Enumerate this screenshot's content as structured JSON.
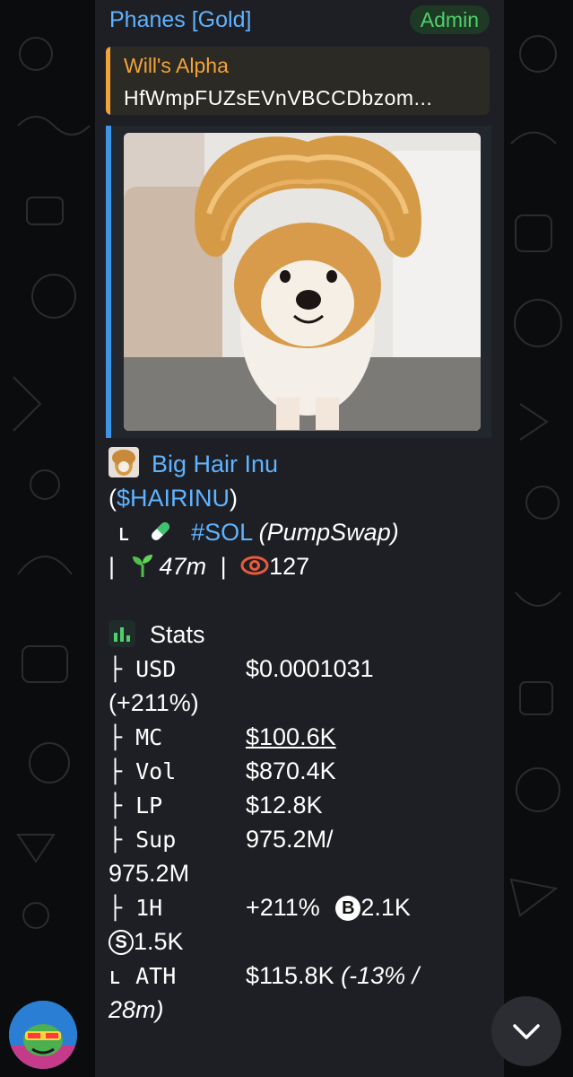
{
  "message": {
    "sender": "Phanes [Gold]",
    "badge": "Admin",
    "reply": {
      "author": "Will's Alpha",
      "text": "HfWmpFUZsEVnVBCCDbzom..."
    },
    "media": {
      "description": "shiba dog with big hair"
    }
  },
  "token": {
    "name": "Big Hair Inu",
    "ticker": "($HAIRINU)",
    "chain_prefix": "ʟ",
    "chain": "#SOL",
    "dex": "(PumpSwap)",
    "sep": "|",
    "age": "47m",
    "sep2": "|",
    "views": "127"
  },
  "stats": {
    "heading": "Stats",
    "rows": [
      {
        "label": "├ USD",
        "value": "$0.0001031"
      },
      {
        "wrap": "(+211%)"
      },
      {
        "label": "├ MC",
        "value": "$100.6K"
      },
      {
        "label": "├ Vol",
        "value": "$870.4K"
      },
      {
        "label": "├ LP",
        "value": "$12.8K"
      },
      {
        "label": "├ Sup",
        "value": "975.2M/"
      },
      {
        "wrap": "975.2M"
      },
      {
        "label": "├ 1H",
        "value": "+211%",
        "b_value": "2.1K"
      },
      {
        "s_value": "1.5K"
      },
      {
        "label": "ʟ ATH",
        "value": "$115.8K",
        "value_italic": "(-13% /"
      },
      {
        "wrap_italic": "28m)"
      }
    ],
    "b_letter": "B",
    "s_letter": "S"
  },
  "colors": {
    "link": "#5fb3ff",
    "admin": "#4fd06a",
    "reply_accent": "#f2a33a",
    "bubble": "#1d1f24"
  },
  "icons": [
    "token-avatar",
    "pill-icon",
    "seedling-icon",
    "eye-icon",
    "bar-chart-icon",
    "chevron-down-icon"
  ]
}
